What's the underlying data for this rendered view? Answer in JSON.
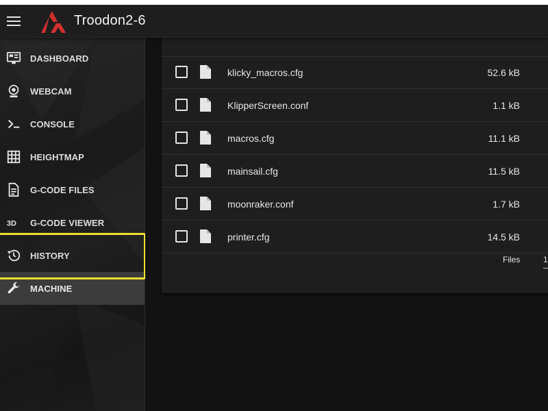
{
  "app": {
    "title": "Troodon2-6",
    "accent_color": "#d32f2f",
    "highlight_color": "#f0e030"
  },
  "sidebar": {
    "items": [
      {
        "label": "DASHBOARD",
        "icon": "monitor-dashboard-icon"
      },
      {
        "label": "WEBCAM",
        "icon": "webcam-icon"
      },
      {
        "label": "CONSOLE",
        "icon": "console-icon"
      },
      {
        "label": "HEIGHTMAP",
        "icon": "grid-icon"
      },
      {
        "label": "G-CODE FILES",
        "icon": "file-document-icon"
      },
      {
        "label": "G-CODE VIEWER",
        "icon": "3d-icon"
      },
      {
        "label": "HISTORY",
        "icon": "history-icon"
      },
      {
        "label": "MACHINE",
        "icon": "wrench-icon",
        "active": true
      }
    ]
  },
  "files": {
    "rows": [
      {
        "name": "",
        "size": ""
      },
      {
        "name": "klicky_macros.cfg",
        "size": "52.6 kB"
      },
      {
        "name": "KlipperScreen.conf",
        "size": "1.1 kB"
      },
      {
        "name": "macros.cfg",
        "size": "11.1 kB"
      },
      {
        "name": "mainsail.cfg",
        "size": "11.5 kB"
      },
      {
        "name": "moonraker.conf",
        "size": "1.7 kB"
      },
      {
        "name": "printer.cfg",
        "size": "14.5 kB"
      }
    ],
    "footer": {
      "label": "Files",
      "value": "1"
    }
  }
}
